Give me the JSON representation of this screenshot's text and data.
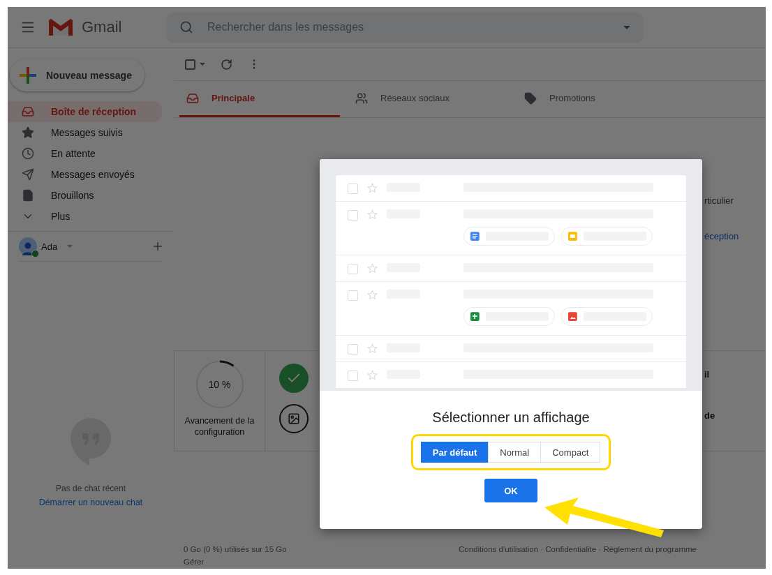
{
  "app": {
    "logo_text": "Gmail"
  },
  "search": {
    "placeholder": "Rechercher dans les messages"
  },
  "toolbar": {
    "select_all": {
      "checked": false
    }
  },
  "compose": {
    "label": "Nouveau message"
  },
  "sidebar": {
    "items": [
      {
        "label": "Boîte de réception",
        "kind": "inbox",
        "selected": true
      },
      {
        "label": "Messages suivis",
        "kind": "star",
        "selected": false
      },
      {
        "label": "En attente",
        "kind": "clock",
        "selected": false
      },
      {
        "label": "Messages envoyés",
        "kind": "send",
        "selected": false
      },
      {
        "label": "Brouillons",
        "kind": "draft",
        "selected": false
      },
      {
        "label": "Plus",
        "kind": "more",
        "selected": false
      }
    ]
  },
  "account": {
    "name": "Ada",
    "online": true
  },
  "chat": {
    "empty_text": "Pas de chat récent",
    "link": "Démarrer un nouveau chat"
  },
  "tabs": [
    {
      "label": "Principale",
      "kind": "inbox",
      "selected": true
    },
    {
      "label": "Réseaux sociaux",
      "kind": "people",
      "selected": false
    },
    {
      "label": "Promotions",
      "kind": "tag",
      "selected": false
    }
  ],
  "cut_texts": [
    {
      "text": "rticulier",
      "kind": "plain"
    },
    {
      "text": "éception",
      "kind": "link"
    }
  ],
  "setup": {
    "progress_label": "10 %",
    "level": 0.1,
    "caption": "Avancement de la configuration",
    "tasks": [
      {
        "kind": "done"
      },
      {
        "kind": "photo"
      }
    ],
    "cut_texts": [
      "il",
      "de"
    ]
  },
  "footer": {
    "storage": "0 Go (0 %) utilisés sur 15 Go",
    "manage": "Gérer",
    "links": "Conditions d'utilisation · Confidentialite · Règlement du programme"
  },
  "dialog": {
    "title": "Sélectionner un affichage",
    "ok": "OK",
    "options": [
      {
        "label": "Par défaut",
        "selected": true
      },
      {
        "label": "Normal",
        "selected": false
      },
      {
        "label": "Compact",
        "selected": false
      }
    ],
    "preview_rows": [
      {
        "kind": "plain"
      },
      {
        "kind": "attachments",
        "attachments": [
          {
            "kind": "docs"
          },
          {
            "kind": "slides"
          }
        ]
      },
      {
        "kind": "plain"
      },
      {
        "kind": "attachments",
        "attachments": [
          {
            "kind": "sheets"
          },
          {
            "kind": "photo"
          }
        ]
      },
      {
        "kind": "plain"
      },
      {
        "kind": "plain"
      }
    ]
  }
}
